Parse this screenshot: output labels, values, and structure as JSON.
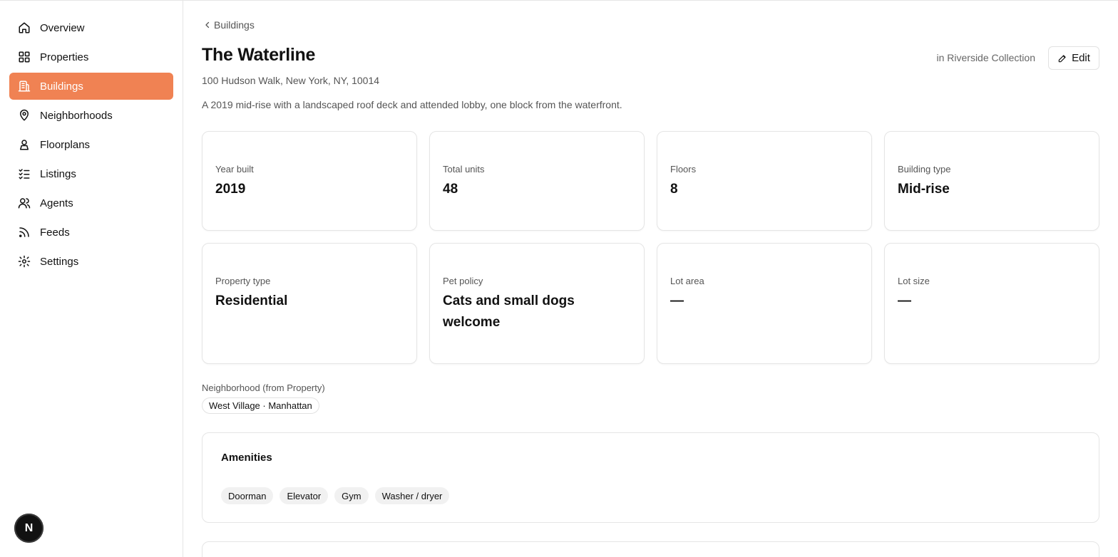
{
  "sidebar": {
    "items": [
      {
        "label": "Overview",
        "icon": "home-icon"
      },
      {
        "label": "Properties",
        "icon": "grid-icon"
      },
      {
        "label": "Buildings",
        "icon": "building-icon",
        "active": true
      },
      {
        "label": "Neighborhoods",
        "icon": "map-pin-icon"
      },
      {
        "label": "Floorplans",
        "icon": "floorplan-icon"
      },
      {
        "label": "Listings",
        "icon": "list-checks-icon"
      },
      {
        "label": "Agents",
        "icon": "users-icon"
      },
      {
        "label": "Feeds",
        "icon": "rss-icon"
      },
      {
        "label": "Settings",
        "icon": "gear-icon"
      }
    ],
    "avatar_letter": "N"
  },
  "header": {
    "breadcrumb": "Buildings",
    "title": "The Waterline",
    "address": "100 Hudson Walk, New York, NY, 10014",
    "description": "A 2019 mid-rise with a landscaped roof deck and attended lobby, one block from the waterfront.",
    "collection": "in Riverside Collection",
    "edit_label": "Edit"
  },
  "stats": [
    {
      "label": "Year built",
      "value": "2019"
    },
    {
      "label": "Total units",
      "value": "48"
    },
    {
      "label": "Floors",
      "value": "8"
    },
    {
      "label": "Building type",
      "value": "Mid-rise"
    },
    {
      "label": "Property type",
      "value": "Residential"
    },
    {
      "label": "Pet policy",
      "value": "Cats and small dogs welcome"
    },
    {
      "label": "Lot area",
      "value": "—"
    },
    {
      "label": "Lot size",
      "value": "—"
    }
  ],
  "neighborhood": {
    "label": "Neighborhood (from Property)",
    "value": "West Village · Manhattan"
  },
  "amenities": {
    "title": "Amenities",
    "items": [
      "Doorman",
      "Elevator",
      "Gym",
      "Washer / dryer"
    ]
  },
  "colors": {
    "accent": "#f08253"
  }
}
